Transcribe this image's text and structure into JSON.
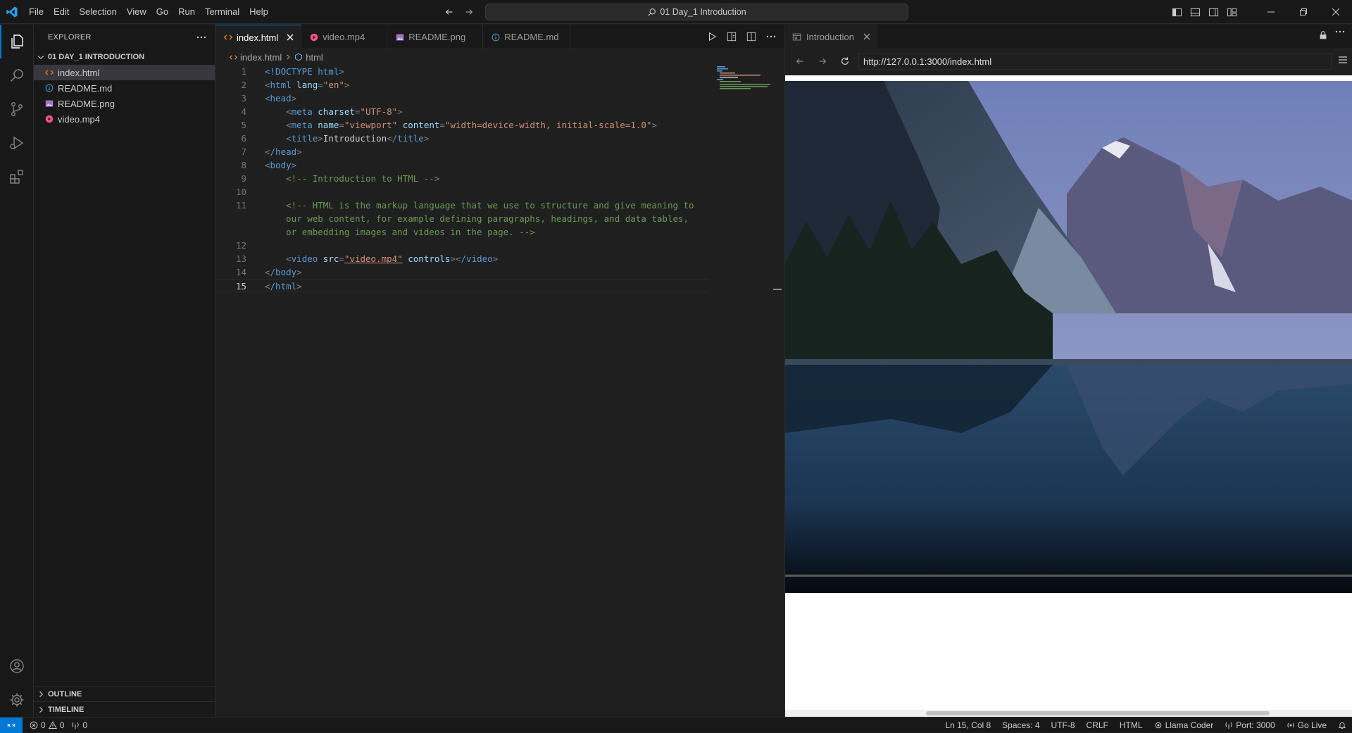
{
  "menu": [
    "File",
    "Edit",
    "Selection",
    "View",
    "Go",
    "Run",
    "Terminal",
    "Help"
  ],
  "command_center": "01 Day_1 Introduction",
  "explorer": {
    "title": "EXPLORER",
    "folder": "01 DAY_1 INTRODUCTION",
    "files": [
      {
        "name": "index.html",
        "icon": "html-file-icon",
        "color": "#e37933"
      },
      {
        "name": "README.md",
        "icon": "info-file-icon",
        "color": "#519aba"
      },
      {
        "name": "README.png",
        "icon": "image-file-icon",
        "color": "#a074c4"
      },
      {
        "name": "video.mp4",
        "icon": "video-file-icon",
        "color": "#f55385"
      }
    ],
    "outline": "OUTLINE",
    "timeline": "TIMELINE"
  },
  "tabs": [
    {
      "label": "index.html",
      "icon": "html-file-icon"
    },
    {
      "label": "video.mp4",
      "icon": "video-file-icon"
    },
    {
      "label": "README.png",
      "icon": "image-file-icon"
    },
    {
      "label": "README.md",
      "icon": "info-file-icon"
    }
  ],
  "breadcrumb": {
    "file": "index.html",
    "symbol": "html"
  },
  "code": {
    "line_numbers": [
      "1",
      "2",
      "3",
      "4",
      "5",
      "6",
      "7",
      "8",
      "9",
      "10",
      "11",
      "",
      "",
      "12",
      "13",
      "14",
      "15"
    ],
    "l1_doctype": "<!DOCTYPE",
    "l1_html": " html",
    "l2_tag": "html",
    "l2_attr": " lang",
    "l2_val": "\"en\"",
    "l3_tag": "head",
    "l4_tag": "meta",
    "l4_attr": " charset",
    "l4_val": "\"UTF-8\"",
    "l5_tag": "meta",
    "l5_attr1": " name",
    "l5_val1": "\"viewport\"",
    "l5_attr2": " content",
    "l5_val2": "\"width=device-width, initial-scale=1.0\"",
    "l6_tag": "title",
    "l6_text": "Introduction",
    "l7_tag": "/head",
    "l8_tag": "body",
    "l9_comment": "<!-- Introduction to HTML -->",
    "l11_comment_a": "<!-- HTML is the markup language that we use to structure and give meaning to",
    "l11_comment_b": "our web content, for example defining paragraphs, headings, and data tables,",
    "l11_comment_c": "or embedding images and videos in the page. -->",
    "l13_tag": "video",
    "l13_attr1": " src",
    "l13_val1": "\"video.mp4\"",
    "l13_attr2": " controls",
    "l13_close": "/video",
    "l14_tag": "/body",
    "l15_tag": "/html"
  },
  "preview": {
    "tab_label": "Introduction",
    "url": "http://127.0.0.1:3000/index.html"
  },
  "status": {
    "errors": "0",
    "warnings": "0",
    "ports": "0",
    "position": "Ln 15, Col 8",
    "spaces": "Spaces: 4",
    "encoding": "UTF-8",
    "eol": "CRLF",
    "language": "HTML",
    "llama": "Llama Coder",
    "port": "Port: 3000",
    "golive": "Go Live"
  },
  "colors": {
    "accent": "#0078d4",
    "html_icon": "#e37933",
    "video_icon": "#f55385",
    "image_icon": "#a074c4",
    "info_icon": "#519aba"
  }
}
